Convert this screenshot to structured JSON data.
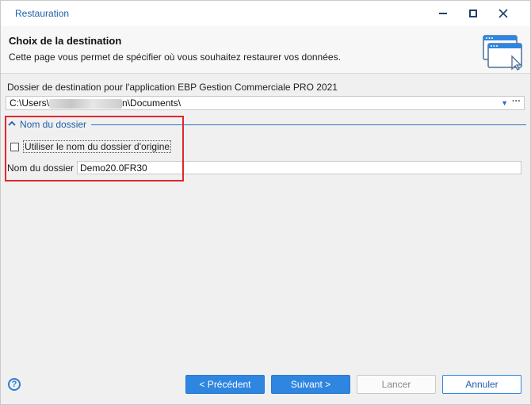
{
  "window": {
    "title": "Restauration"
  },
  "header": {
    "title": "Choix de la destination",
    "subtitle": "Cette page vous permet de spécifier où vous souhaitez restaurer vos données.",
    "icon": "window-cursor-icon"
  },
  "destination": {
    "label": "Dossier de destination pour l'application EBP Gestion Commerciale PRO 2021",
    "path_prefix": "C:\\Users\\",
    "path_suffix": "n\\Documents\\"
  },
  "folder_section": {
    "title": "Nom du dossier",
    "use_original_label": "Utiliser le nom du dossier d'origine",
    "use_original_checked": false,
    "name_label": "Nom du dossier",
    "name_value": "Demo20.0FR30"
  },
  "footer": {
    "previous_label": "< Précédent",
    "next_label": "Suivant >",
    "cancel_label": "Lancer",
    "annul_label": "Annuler"
  },
  "colors": {
    "accent": "#2f86e0",
    "link": "#1f5fa8",
    "highlight": "#e0262e"
  }
}
